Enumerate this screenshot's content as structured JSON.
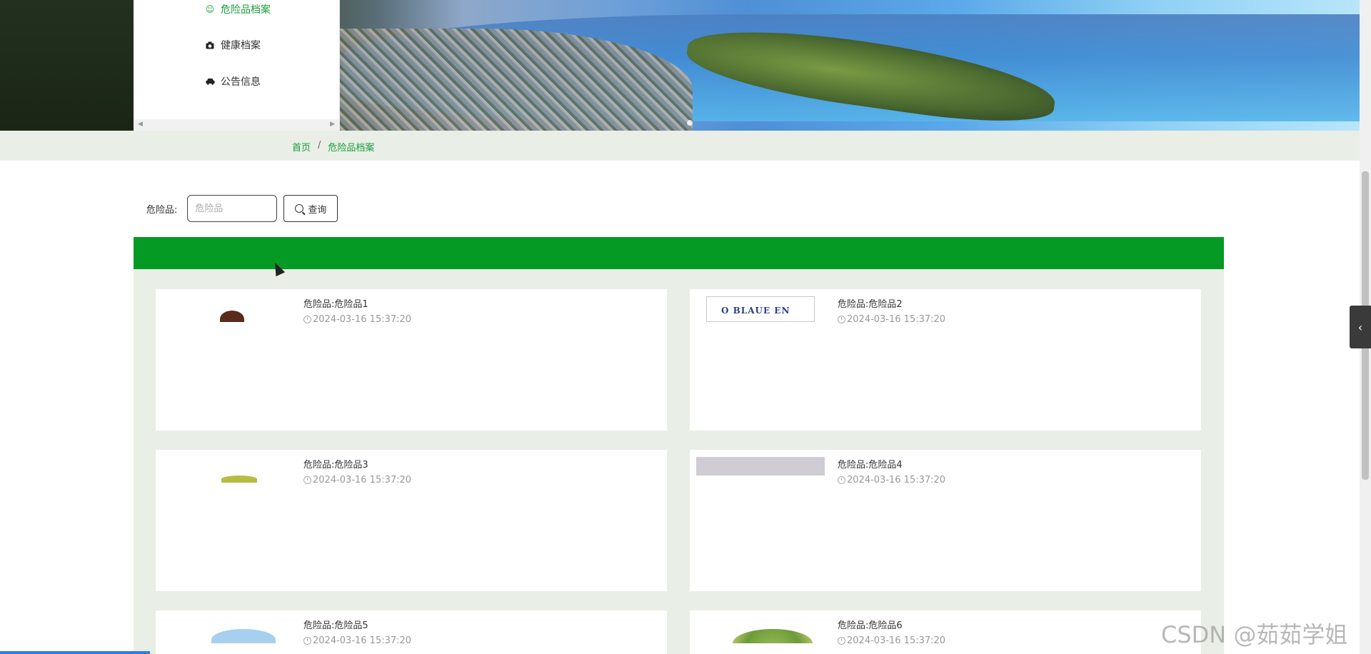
{
  "menu": {
    "items": [
      {
        "label": "危险品档案",
        "icon": "smile-icon",
        "active": true
      },
      {
        "label": "健康档案",
        "icon": "camera-icon",
        "active": false
      },
      {
        "label": "公告信息",
        "icon": "car-icon",
        "active": false
      }
    ]
  },
  "breadcrumb": {
    "home": "首页",
    "separator": "/",
    "current": "危险品档案"
  },
  "search": {
    "label": "危险品:",
    "placeholder": "危险品",
    "button_label": "查询"
  },
  "list": {
    "items": [
      {
        "title": "危险品:危险品1",
        "time": "2024-03-16 15:37:20",
        "thumb": "hair"
      },
      {
        "title": "危险品:危险品2",
        "time": "2024-03-16 15:37:20",
        "thumb": "badge",
        "thumb_text": "O BLAUE EN"
      },
      {
        "title": "危险品:危险品3",
        "time": "2024-03-16 15:37:20",
        "thumb": "grass"
      },
      {
        "title": "危险品:危险品4",
        "time": "2024-03-16 15:37:20",
        "thumb": "grey"
      },
      {
        "title": "危险品:危险品5",
        "time": "2024-03-16 15:37:20",
        "thumb": "fish"
      },
      {
        "title": "危险品:危险品6",
        "time": "2024-03-16 15:37:20",
        "thumb": "globe"
      }
    ]
  },
  "watermark": "CSDN @茹茹学姐",
  "colors": {
    "accent_green": "#059a24",
    "link_green": "#169d3a",
    "strip_bg": "#e9eee6"
  }
}
